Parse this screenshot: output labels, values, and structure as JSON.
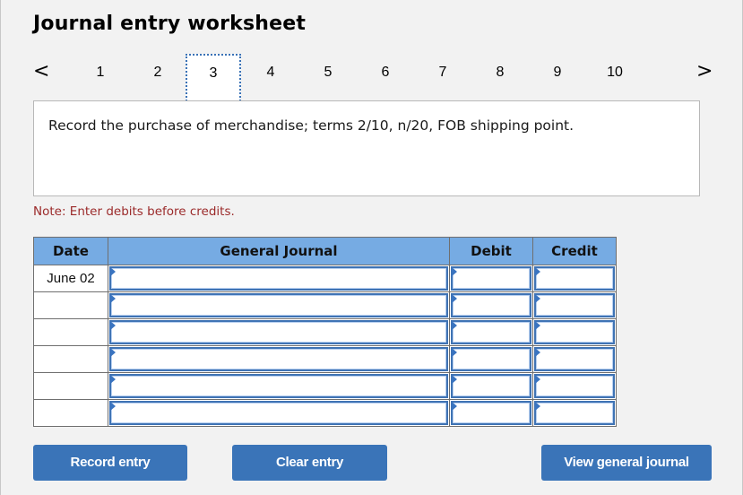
{
  "header": {
    "title": "Journal entry worksheet"
  },
  "pager": {
    "prev_icon": "<",
    "next_icon": ">",
    "pages": [
      "1",
      "2",
      "3",
      "4",
      "5",
      "6",
      "7",
      "8",
      "9",
      "10"
    ],
    "active_page": "3"
  },
  "prompt": {
    "text": "Record the purchase of merchandise; terms 2/10, n/20, FOB shipping point."
  },
  "note": "Note: Enter debits before credits.",
  "journal": {
    "columns": [
      "Date",
      "General Journal",
      "Debit",
      "Credit"
    ],
    "rows": [
      {
        "date": "June 02",
        "account": "",
        "debit": "",
        "credit": ""
      },
      {
        "date": "",
        "account": "",
        "debit": "",
        "credit": ""
      },
      {
        "date": "",
        "account": "",
        "debit": "",
        "credit": ""
      },
      {
        "date": "",
        "account": "",
        "debit": "",
        "credit": ""
      },
      {
        "date": "",
        "account": "",
        "debit": "",
        "credit": ""
      },
      {
        "date": "",
        "account": "",
        "debit": "",
        "credit": ""
      }
    ]
  },
  "buttons": {
    "record": "Record entry",
    "clear": "Clear entry",
    "view": "View general journal"
  },
  "colors": {
    "accent": "#3a74b8",
    "header_bg": "#76abe3",
    "note": "#9b2a2a"
  }
}
